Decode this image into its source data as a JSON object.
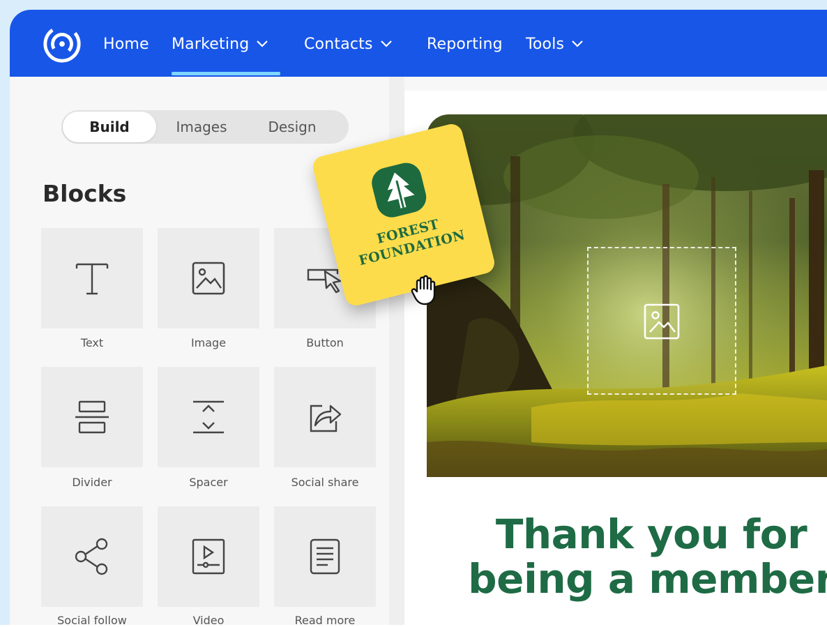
{
  "nav": {
    "items": [
      {
        "label": "Home",
        "dropdown": false
      },
      {
        "label": "Marketing",
        "dropdown": true,
        "active": true
      },
      {
        "label": "Contacts",
        "dropdown": true
      },
      {
        "label": "Reporting",
        "dropdown": false
      },
      {
        "label": "Tools",
        "dropdown": true
      }
    ]
  },
  "sidebar": {
    "tabs": [
      {
        "label": "Build",
        "active": true
      },
      {
        "label": "Images"
      },
      {
        "label": "Design"
      }
    ],
    "blocks_title": "Blocks",
    "blocks": [
      {
        "label": "Text",
        "icon": "text-icon"
      },
      {
        "label": "Image",
        "icon": "image-icon"
      },
      {
        "label": "Button",
        "icon": "button-icon"
      },
      {
        "label": "Divider",
        "icon": "divider-icon"
      },
      {
        "label": "Spacer",
        "icon": "spacer-icon"
      },
      {
        "label": "Social share",
        "icon": "social-share-icon"
      },
      {
        "label": "Social follow",
        "icon": "social-follow-icon"
      },
      {
        "label": "Video",
        "icon": "video-icon"
      },
      {
        "label": "Read more",
        "icon": "read-more-icon"
      }
    ]
  },
  "drag_card": {
    "line1": "FOREST",
    "line2": "FOUNDATION"
  },
  "canvas": {
    "headline_line1": "Thank you for",
    "headline_line2": "being a member"
  },
  "colors": {
    "nav_bg": "#1856e8",
    "nav_active_underline": "#7fd6ff",
    "brand_green": "#1e6b45",
    "card_yellow": "#fddc4c"
  }
}
